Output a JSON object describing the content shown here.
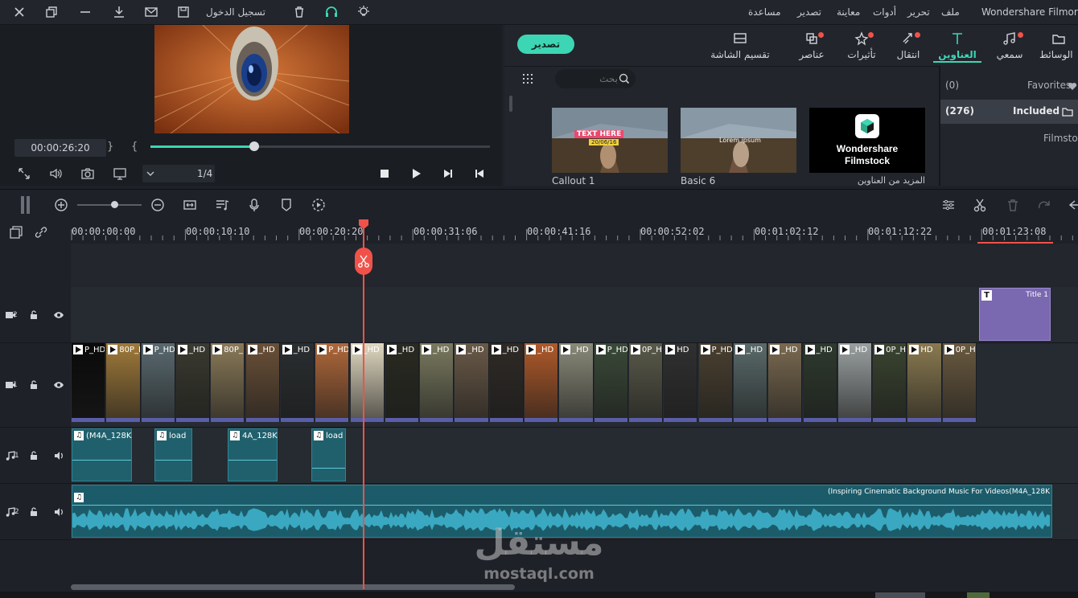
{
  "menubar": {
    "app_title": "Wondershare Filmora",
    "menu_items": [
      "ملف",
      "تحرير",
      "أدوات",
      "معاينة",
      "تصدير",
      "مساعدة"
    ],
    "login_label": "تسجيل الدخول"
  },
  "preview": {
    "timecode": "00:00:26:20",
    "brace_left": "}",
    "brace_right": "{",
    "progress": 0.305,
    "zoom_fraction": "1/4"
  },
  "media_tabs": [
    {
      "label": "الوسائط",
      "icon": "folder-icon",
      "dot": false
    },
    {
      "label": "سمعي",
      "icon": "music-icon",
      "dot": true
    },
    {
      "label": "العناوين",
      "icon": "title-icon",
      "dot": false,
      "active": true
    },
    {
      "label": "انتقال",
      "icon": "transition-icon",
      "dot": true
    },
    {
      "label": "تأثيرات",
      "icon": "effects-icon",
      "dot": true
    },
    {
      "label": "عناصر",
      "icon": "elements-icon",
      "dot": true
    },
    {
      "label": "تقسيم الشاشة",
      "icon": "split-screen-icon",
      "dot": false
    }
  ],
  "export_button": "تصدير",
  "search": {
    "placeholder": "بحث"
  },
  "categories": [
    {
      "label": "Favorites",
      "count": "(0)"
    },
    {
      "label": "Included",
      "count": "(276)"
    },
    {
      "label": "Filmstock",
      "count": ""
    }
  ],
  "title_thumbs": [
    {
      "label": "Callout 1",
      "overlay_text": "TEXT HERE",
      "overlay_date": "20/06/16"
    },
    {
      "label": "Basic 6",
      "overlay_text": "Lorem ipsum"
    },
    {
      "label": "المزيد من العناوين",
      "brand_line1": "Wondershare",
      "brand_line2": "Filmstock"
    }
  ],
  "ruler": {
    "ticks": [
      "00:00:00:00",
      "00:00:10:10",
      "00:00:20:20",
      "00:00:31:06",
      "00:00:41:16",
      "00:00:52:02",
      "00:01:02:12",
      "00:01:12:22",
      "00:01:23:08"
    ]
  },
  "tracks": {
    "title_track": {
      "num": "2",
      "clip_label": "Title 1"
    },
    "video_track": {
      "num": "1",
      "clip_labels": [
        "P_HD",
        "80P_HD",
        "P_HD",
        "_HD",
        "80P_HD",
        "_HD",
        "_HD",
        "P_HD",
        "_HD",
        "_HD",
        "_HD",
        "_HD",
        "_HD",
        "_HD",
        "_HD",
        "P_HD",
        "0P_HD",
        "HD",
        "P_HD",
        "_HD",
        "_HD",
        "_HD",
        "_HD",
        "0P_HD",
        "HD",
        "0P_HD"
      ]
    },
    "audio_track_1": {
      "num": "1",
      "clip_labels": [
        "(M4A_128K",
        "load",
        "4A_128K",
        "load"
      ]
    },
    "audio_track_2": {
      "num": "2",
      "clip_label": "(Inspiring Cinematic Background Music For Videos(M4A_128K"
    }
  },
  "watermark": {
    "arabic": "مستقل",
    "latin": "mostaql.com"
  },
  "colors": {
    "accent": "#3dd6b4",
    "playhead": "#f0524a",
    "title_clip": "#7a68b0",
    "audio_clip": "#20606c"
  }
}
